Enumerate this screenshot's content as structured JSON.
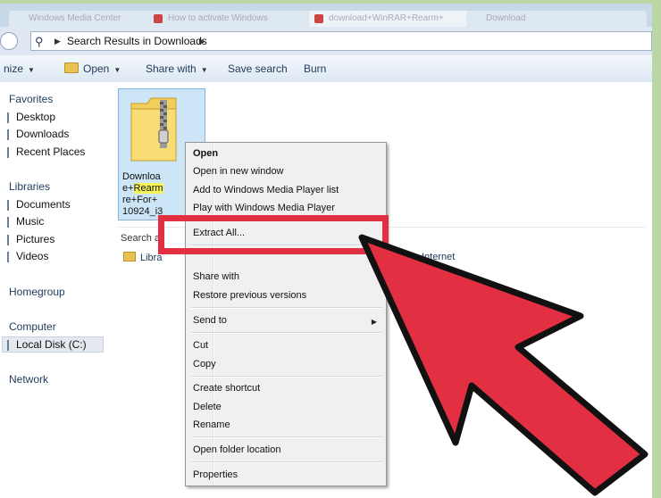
{
  "tabs": [
    {
      "label": "Windows Media Center"
    },
    {
      "label": "How to activate Windows"
    },
    {
      "label": "download+WinRAR+Rearm+"
    },
    {
      "label": "Download"
    }
  ],
  "address": {
    "path": "Search Results in Downloads"
  },
  "toolbar": {
    "organize": "nize",
    "open": "Open",
    "share_with": "Share with",
    "save_search": "Save search",
    "burn": "Burn"
  },
  "nav": {
    "favorites": "Favorites",
    "desktop": "Desktop",
    "downloads": "Downloads",
    "recent_places": "Recent Places",
    "libraries": "Libraries",
    "documents": "Documents",
    "music": "Music",
    "pictures": "Pictures",
    "videos": "Videos",
    "homegroup": "Homegroup",
    "computer": "Computer",
    "local_disk": "Local Disk (C:)",
    "network": "Network"
  },
  "file": {
    "line1": "Downloa",
    "line2_pre": "e+",
    "line2_hl": "Rearm",
    "line3": "re+For+",
    "line4": "10924_i3"
  },
  "search_again": "Search a",
  "libraries_link": "Libra",
  "internet_link": "Internet",
  "context_menu": {
    "open": "Open",
    "open_new_window": "Open in new window",
    "add_wmp_list": "Add to Windows Media Player list",
    "play_wmp": "Play with Windows Media Player",
    "extract_all": "Extract All...",
    "share_with": "Share with",
    "restore_versions": "Restore previous versions",
    "send_to": "Send to",
    "cut": "Cut",
    "copy": "Copy",
    "create_shortcut": "Create shortcut",
    "delete": "Delete",
    "rename": "Rename",
    "open_folder_location": "Open folder location",
    "properties": "Properties"
  },
  "colors": {
    "highlight_red": "#e22f42",
    "frame_green": "#bcd7a6"
  }
}
